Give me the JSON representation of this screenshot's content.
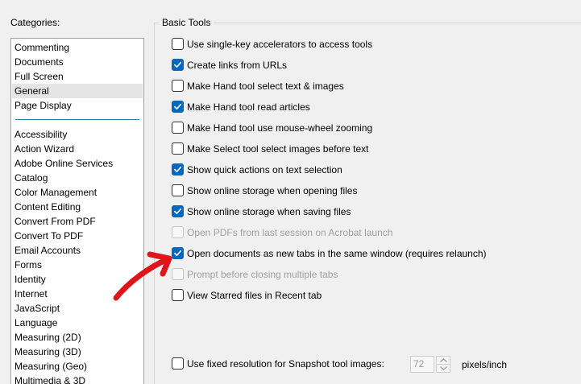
{
  "categories": {
    "label": "Categories:",
    "items_top": [
      {
        "label": "Commenting",
        "selected": false
      },
      {
        "label": "Documents",
        "selected": false
      },
      {
        "label": "Full Screen",
        "selected": false
      },
      {
        "label": "General",
        "selected": true
      },
      {
        "label": "Page Display",
        "selected": false
      }
    ],
    "items_bottom": [
      {
        "label": "Accessibility"
      },
      {
        "label": "Action Wizard"
      },
      {
        "label": "Adobe Online Services"
      },
      {
        "label": "Catalog"
      },
      {
        "label": "Color Management"
      },
      {
        "label": "Content Editing"
      },
      {
        "label": "Convert From PDF"
      },
      {
        "label": "Convert To PDF"
      },
      {
        "label": "Email Accounts"
      },
      {
        "label": "Forms"
      },
      {
        "label": "Identity"
      },
      {
        "label": "Internet"
      },
      {
        "label": "JavaScript"
      },
      {
        "label": "Language"
      },
      {
        "label": "Measuring (2D)"
      },
      {
        "label": "Measuring (3D)"
      },
      {
        "label": "Measuring (Geo)"
      },
      {
        "label": "Multimedia & 3D"
      }
    ]
  },
  "basic_tools": {
    "title": "Basic Tools",
    "options": [
      {
        "label": "Use single-key accelerators to access tools",
        "checked": false,
        "disabled": false
      },
      {
        "label": "Create links from URLs",
        "checked": true,
        "disabled": false
      },
      {
        "label": "Make Hand tool select text & images",
        "checked": false,
        "disabled": false
      },
      {
        "label": "Make Hand tool read articles",
        "checked": true,
        "disabled": false
      },
      {
        "label": "Make Hand tool use mouse-wheel zooming",
        "checked": false,
        "disabled": false
      },
      {
        "label": "Make Select tool select images before text",
        "checked": false,
        "disabled": false
      },
      {
        "label": "Show quick actions on text selection",
        "checked": true,
        "disabled": false
      },
      {
        "label": "Show online storage when opening files",
        "checked": false,
        "disabled": false
      },
      {
        "label": "Show online storage when saving files",
        "checked": true,
        "disabled": false
      },
      {
        "label": "Open PDFs from last session on Acrobat launch",
        "checked": false,
        "disabled": true
      },
      {
        "label": "Open documents as new tabs in the same window (requires relaunch)",
        "checked": true,
        "disabled": false
      },
      {
        "label": "Prompt before closing multiple tabs",
        "checked": false,
        "disabled": true
      },
      {
        "label": "View Starred files in Recent tab",
        "checked": false,
        "disabled": false
      }
    ],
    "snapshot": {
      "label": "Use fixed resolution for Snapshot tool images:",
      "checked": false,
      "value": "72",
      "units": "pixels/inch"
    }
  },
  "colors": {
    "checkbox_checked": "#0067c0",
    "selection_bg": "#e5e5e5",
    "divider": "#2a7fa5",
    "annotation_arrow": "#e0151b",
    "disabled_text": "#a0a0a0"
  },
  "icons": {
    "check": "checkmark-icon",
    "spin_up": "chevron-up-icon",
    "spin_down": "chevron-down-icon",
    "annotation": "red-arrow-icon"
  }
}
